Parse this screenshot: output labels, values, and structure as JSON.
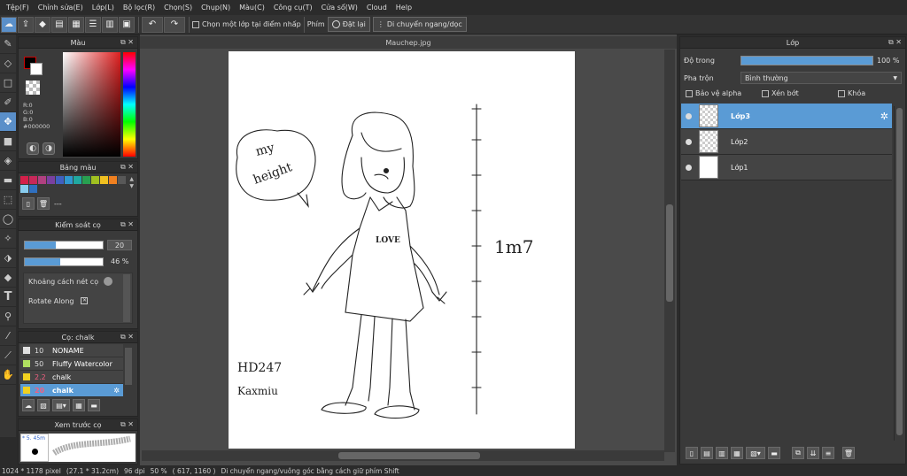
{
  "menu": [
    "Tệp(F)",
    "Chỉnh sửa(E)",
    "Lớp(L)",
    "Bộ lọc(R)",
    "Chọn(S)",
    "Chụp(N)",
    "Màu(C)",
    "Công cụ(T)",
    "Cửa sổ(W)",
    "Cloud",
    "Help"
  ],
  "toolbar": {
    "snap_checkbox_label": "Chọn một lớp tại điểm nhấp",
    "phim_label": "Phím",
    "reset_label": "Đặt lại",
    "move_mode_label": "Di chuyển ngang/dọc"
  },
  "color_panel": {
    "title": "Màu",
    "r": "R:0",
    "g": "G:0",
    "b": "B:0",
    "hex": "#000000",
    "current_color": "#000000"
  },
  "palette_panel": {
    "title": "Bảng màu",
    "swatches": [
      "#d4204a",
      "#c8285a",
      "#b04080",
      "#7a40a0",
      "#4060c0",
      "#3098d0",
      "#20a8a0",
      "#28a050",
      "#a0c020",
      "#f0c020",
      "#f08020",
      "#585858"
    ],
    "row2": [
      "#88ccee",
      "#3070c0"
    ],
    "empty_label": "---"
  },
  "brush_control": {
    "title": "Kiểm soát cọ",
    "size_value": "20",
    "opacity_value": "46 %",
    "spacing_label": "Khoảng cách nét cọ",
    "rotate_label": "Rotate Along",
    "size_fill": 0.4,
    "opacity_fill": 0.46
  },
  "brush_panel": {
    "title": "Cọ: chalk",
    "items": [
      {
        "size": "10",
        "name": "NONAME",
        "swatch": "#e0e0e0"
      },
      {
        "size": "50",
        "name": "Fluffy Watercolor",
        "swatch": "#b0e060"
      },
      {
        "size": "2.2",
        "name": "chalk",
        "swatch": "#f0d020"
      },
      {
        "size": "20",
        "name": "chalk",
        "swatch": "#f0d020"
      }
    ]
  },
  "preview_panel": {
    "title": "Xem trước cọ",
    "size_label": "* 5. 45m"
  },
  "document": {
    "tab_title": "Mauchep.jpg"
  },
  "layer_panel": {
    "title": "Lớp",
    "opacity_label": "Độ trong",
    "opacity_value": "100 %",
    "opacity_fill": 1.0,
    "blend_label": "Pha trộn",
    "blend_value": "Bình thường",
    "protect_alpha": "Bảo vệ alpha",
    "clipping": "Xén bớt",
    "lock": "Khóa",
    "layers": [
      {
        "name": "Lớp3",
        "selected": true,
        "thumb": "transparent"
      },
      {
        "name": "Lớp2",
        "selected": false,
        "thumb": "transparent"
      },
      {
        "name": "Lớp1",
        "selected": false,
        "thumb": "white"
      }
    ]
  },
  "drawing": {
    "bubble_text_1": "my",
    "bubble_text_2": "height",
    "shirt_text": "LOVE",
    "height_text": "1m7",
    "signature_1": "HD247",
    "signature_2": "Kaxmiu"
  },
  "status": {
    "size": "1024 * 1178 pixel",
    "cm": "(27.1 * 31.2cm)",
    "dpi": "96 dpi",
    "zoom": "50 %",
    "coords": "( 617, 1160 )",
    "hint": "Di chuyển ngang/vuông góc bằng cách giữ phím Shift"
  }
}
